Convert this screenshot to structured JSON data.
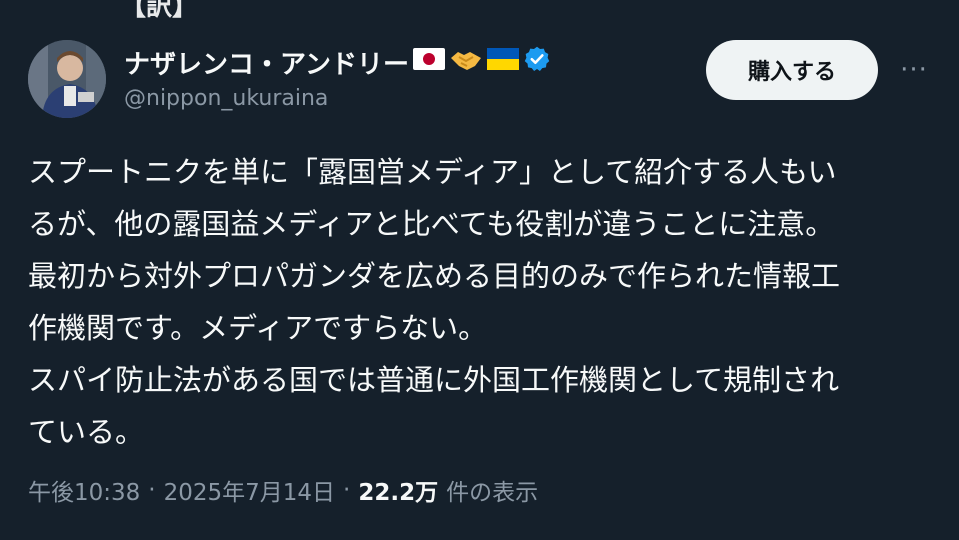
{
  "header_fragment": "【訳】",
  "author": {
    "name": "ナザレンコ・アンドリー",
    "handle": "@nippon_ukuraina",
    "badges": [
      "japan-flag-icon",
      "handshake-icon",
      "ukraine-flag-icon",
      "verified-badge-icon"
    ],
    "verified_color": "#1d9bf0"
  },
  "actions": {
    "buy_label": "購入する",
    "more_label": "···"
  },
  "tweet": {
    "lines": [
      "スプートニクを単に「露国営メディア」として紹介する人もい",
      "るが、他の露国益メディアと比べても役割が違うことに注意。",
      "最初から対外プロパガンダを広める目的のみで作られた情報工",
      "作機関です。メディアですらない。",
      "スパイ防止法がある国では普通に外国工作機関として規制され",
      "ている。"
    ]
  },
  "meta": {
    "time": "午後10:38",
    "separator": "·",
    "date": "2025年7月14日",
    "views_count": "22.2万",
    "views_label": "件の表示"
  },
  "colors": {
    "background": "#15202b",
    "text": "#f7f9f9",
    "secondary": "#8b98a5",
    "button_bg": "#eff3f4"
  }
}
